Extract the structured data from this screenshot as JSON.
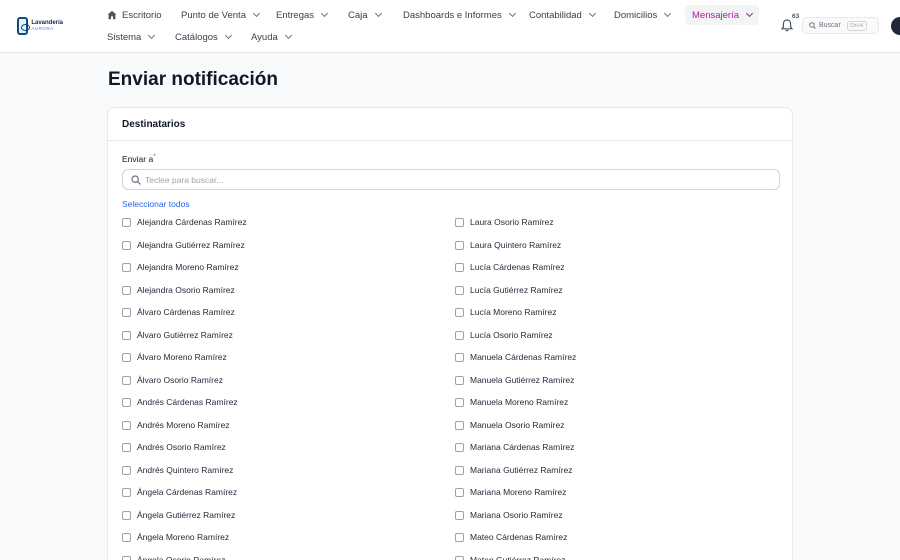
{
  "brand": {
    "name": "Lavandería",
    "subtitle": "AURORA"
  },
  "nav": {
    "row1": [
      {
        "label": "Escritorio",
        "icon": "home-icon"
      },
      {
        "label": "Punto de Venta"
      },
      {
        "label": "Entregas"
      },
      {
        "label": "Caja"
      },
      {
        "label": "Dashboards e Informes"
      },
      {
        "label": "Contabilidad"
      },
      {
        "label": "Domicilios"
      },
      {
        "label": "Mensajería",
        "active": true
      }
    ],
    "row2": [
      {
        "label": "Sistema"
      },
      {
        "label": "Catálogos"
      },
      {
        "label": "Ayuda"
      }
    ],
    "notifications_count": "63",
    "search_label": "Buscar",
    "search_shortcut": "Ctrl+K",
    "accent_color": "#b5179e"
  },
  "page": {
    "title": "Enviar notificación"
  },
  "card": {
    "title": "Destinatarios",
    "field_label": "Enviar a",
    "required_mark": "*",
    "search_placeholder": "Teclee para buscar...",
    "select_all": "Seleccionar todos"
  },
  "recipients_left": [
    {
      "name": "Alejandra Cárdenas Ramírez"
    },
    {
      "name": "Alejandra Gutiérrez Ramírez"
    },
    {
      "name": "Alejandra Moreno Ramírez"
    },
    {
      "name": "Alejandra Osorio Ramírez"
    },
    {
      "name": "Álvaro Cárdenas Ramírez"
    },
    {
      "name": "Álvaro Gutiérrez Ramírez"
    },
    {
      "name": "Álvaro Moreno Ramírez"
    },
    {
      "name": "Álvaro Osorio Ramírez"
    },
    {
      "name": "Andrés Cárdenas Ramírez"
    },
    {
      "name": "Andrés Moreno Ramírez"
    },
    {
      "name": "Andrés Osorio Ramírez"
    },
    {
      "name": "Andrés Quintero Ramírez"
    },
    {
      "name": "Ángela Cárdenas Ramírez"
    },
    {
      "name": "Ángela Gutiérrez Ramírez"
    },
    {
      "name": "Ángela Moreno Ramírez"
    },
    {
      "name": "Ángela Osorio Ramírez"
    }
  ],
  "recipients_right": [
    {
      "name": "Laura Osorio Ramírez"
    },
    {
      "name": "Laura Quintero Ramírez"
    },
    {
      "name": "Lucía Cárdenas Ramírez"
    },
    {
      "name": "Lucía Gutiérrez Ramírez"
    },
    {
      "name": "Lucía Moreno Ramírez"
    },
    {
      "name": "Lucía Osorio Ramírez"
    },
    {
      "name": "Manuela Cárdenas Ramírez"
    },
    {
      "name": "Manuela Gutiérrez Ramírez"
    },
    {
      "name": "Manuela Moreno Ramírez"
    },
    {
      "name": "Manuela Osorio Ramírez"
    },
    {
      "name": "Mariana Cárdenas Ramírez"
    },
    {
      "name": "Mariana Gutiérrez Ramírez"
    },
    {
      "name": "Mariana Moreno Ramírez"
    },
    {
      "name": "Mariana Osorio Ramírez"
    },
    {
      "name": "Mateo Cárdenas Ramírez"
    },
    {
      "name": "Mateo Gutiérrez Ramírez"
    }
  ]
}
